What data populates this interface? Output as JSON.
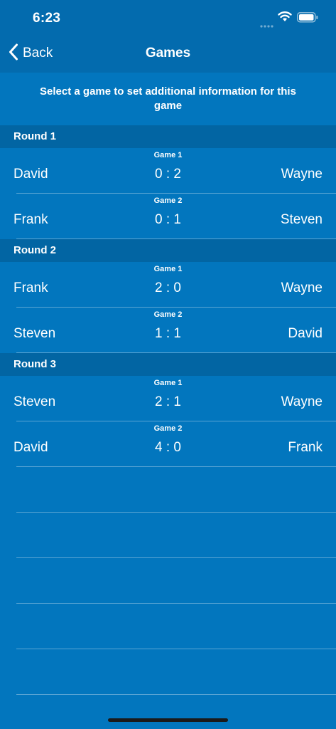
{
  "status_bar": {
    "time": "6:23"
  },
  "nav": {
    "back_label": "Back",
    "title": "Games"
  },
  "instruction": "Select a game to set additional information for this game",
  "rounds": [
    {
      "title": "Round 1",
      "games": [
        {
          "label": "Game 1",
          "player_a": "David",
          "score": "0 : 2",
          "player_b": "Wayne"
        },
        {
          "label": "Game 2",
          "player_a": "Frank",
          "score": "0 : 1",
          "player_b": "Steven"
        }
      ]
    },
    {
      "title": "Round 2",
      "games": [
        {
          "label": "Game 1",
          "player_a": "Frank",
          "score": "2 : 0",
          "player_b": "Wayne"
        },
        {
          "label": "Game 2",
          "player_a": "Steven",
          "score": "1 : 1",
          "player_b": "David"
        }
      ]
    },
    {
      "title": "Round 3",
      "games": [
        {
          "label": "Game 1",
          "player_a": "Steven",
          "score": "2 : 1",
          "player_b": "Wayne"
        },
        {
          "label": "Game 2",
          "player_a": "David",
          "score": "4 : 0",
          "player_b": "Frank"
        }
      ]
    }
  ],
  "colors": {
    "background": "#0276BE",
    "bar": "#036BAE",
    "section_header": "#0265A3"
  }
}
